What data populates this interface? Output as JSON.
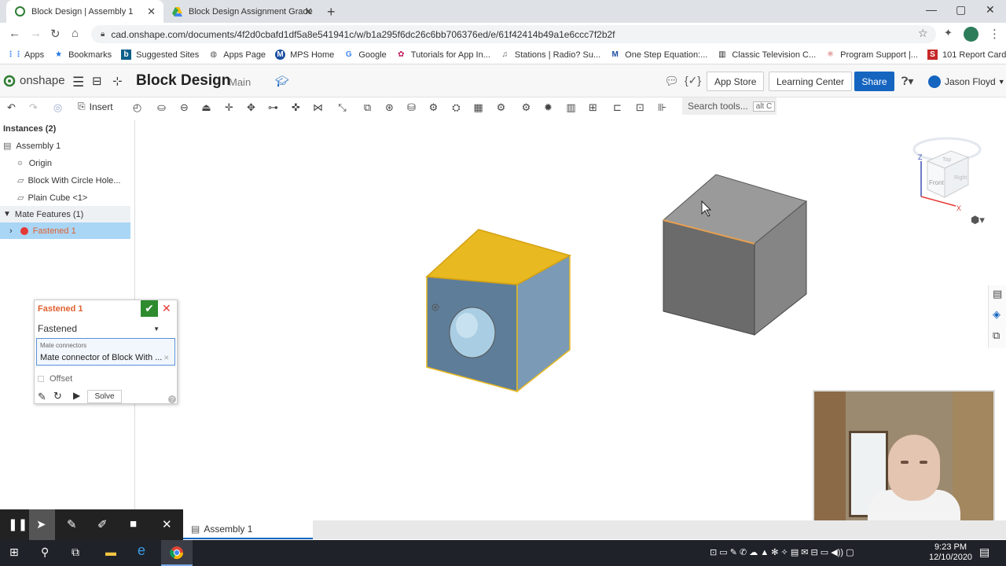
{
  "browser": {
    "tabs": [
      {
        "title": "Block Design | Assembly 1",
        "active": true
      },
      {
        "title": "Block Design Assignment Grade",
        "active": false
      }
    ],
    "url": "cad.onshape.com/documents/4f2d0cbafd1df5a8e541941c/w/b1a295f6dc26c6bb706376ed/e/61f42414b49a1e6ccc7f2b2f",
    "bookmarks": [
      "Apps",
      "Bookmarks",
      "Suggested Sites",
      "Apps Page",
      "MPS Home",
      "Google",
      "Tutorials for App In...",
      "Stations | Radio? Su...",
      "One Step Equation:...",
      "Classic Television C...",
      "Program Support |...",
      "101 Report Card Co..."
    ]
  },
  "header": {
    "logo": "onshape",
    "doc_title": "Block Design",
    "workspace": "Main",
    "app_store": "App Store",
    "learning_center": "Learning Center",
    "share": "Share",
    "user": "Jason Floyd"
  },
  "toolbar": {
    "insert": "Insert",
    "search_placeholder": "Search tools...",
    "search_shortcut": "alt C"
  },
  "tree": {
    "instances_header": "Instances (2)",
    "items": [
      "Assembly 1",
      "Origin",
      "Block With Circle Hole...",
      "Plain Cube <1>"
    ],
    "mate_header": "Mate Features (1)",
    "mate_item": "Fastened 1"
  },
  "mate_dialog": {
    "title": "Fastened 1",
    "type": "Fastened",
    "connectors_label": "Mate connectors",
    "connector_value": "Mate connector of Block With ...",
    "offset": "Offset",
    "solve": "Solve"
  },
  "viewcube": {
    "top": "Top",
    "front": "Front",
    "right": "Right",
    "axis_z": "Z",
    "axis_x": "X"
  },
  "bottom": {
    "tab": "Assembly 1"
  },
  "taskbar": {
    "time": "9:23 PM",
    "date": "12/10/2020"
  },
  "colors": {
    "accent": "#1565c0",
    "selected_face": "#e8b920",
    "block_face": "#5e7d99",
    "cube_face": "#6b6b6b"
  }
}
